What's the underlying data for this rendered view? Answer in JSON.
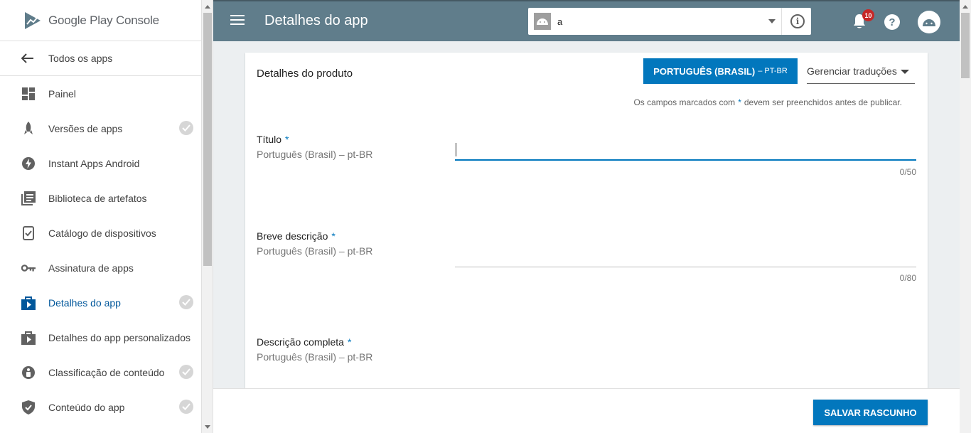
{
  "sidebar": {
    "logo": {
      "brand": "Google Play",
      "product": "Console"
    },
    "back_label": "Todos os apps",
    "items": [
      {
        "label": "Painel",
        "icon": "dashboard-icon",
        "checked": false,
        "active": false
      },
      {
        "label": "Versões de apps",
        "icon": "rocket-icon",
        "checked": true,
        "active": false
      },
      {
        "label": "Instant Apps Android",
        "icon": "bolt-icon",
        "checked": false,
        "active": false
      },
      {
        "label": "Biblioteca de artefatos",
        "icon": "library-icon",
        "checked": false,
        "active": false
      },
      {
        "label": "Catálogo de dispositivos",
        "icon": "device-icon",
        "checked": false,
        "active": false
      },
      {
        "label": "Assinatura de apps",
        "icon": "key-icon",
        "checked": false,
        "active": false
      },
      {
        "label": "Detalhes do app",
        "icon": "store-icon",
        "checked": true,
        "active": true
      },
      {
        "label": "Detalhes do app personalizados",
        "icon": "store-icon",
        "checked": false,
        "active": false
      },
      {
        "label": "Classificação de conteúdo",
        "icon": "rating-icon",
        "checked": true,
        "active": false
      },
      {
        "label": "Conteúdo do app",
        "icon": "shield-icon",
        "checked": true,
        "active": false
      }
    ]
  },
  "header": {
    "title": "Detalhes do app",
    "app_selector": {
      "value": "a"
    },
    "notification_count": "10"
  },
  "card": {
    "title": "Detalhes do produto",
    "language_button": {
      "main": "PORTUGUÊS (BRASIL)",
      "sub": "– PT-BR"
    },
    "manage_translations": "Gerenciar traduções",
    "required_note": {
      "before": "Os campos marcados com",
      "star": "*",
      "after": "devem ser preenchidos antes de publicar."
    },
    "fields": {
      "title": {
        "label": "Título",
        "star": "*",
        "sub": "Português (Brasil) – pt-BR",
        "value": "",
        "counter": "0/50"
      },
      "short_description": {
        "label": "Breve descrição",
        "star": "*",
        "sub": "Português (Brasil) – pt-BR",
        "value": "",
        "counter": "0/80"
      },
      "full_description": {
        "label": "Descrição completa",
        "star": "*",
        "sub": "Português (Brasil) – pt-BR"
      }
    }
  },
  "footer": {
    "save_label": "SALVAR RASCUNHO"
  },
  "colors": {
    "header": "#607d8b",
    "accent": "#0277bd",
    "active_nav": "#01579b"
  }
}
